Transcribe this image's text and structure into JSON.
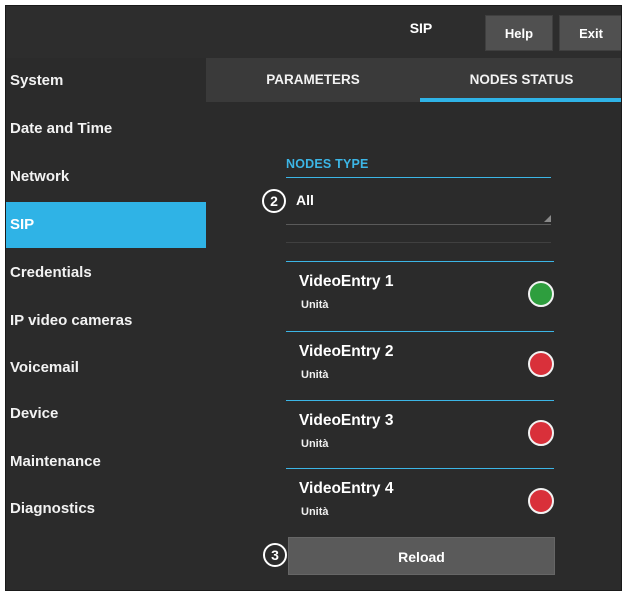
{
  "header": {
    "title": "SIP",
    "help_label": "Help",
    "exit_label": "Exit"
  },
  "sidebar": {
    "items": [
      {
        "label": "System",
        "active": false
      },
      {
        "label": "Date and Time",
        "active": false
      },
      {
        "label": "Network",
        "active": false
      },
      {
        "label": "SIP",
        "active": true
      },
      {
        "label": "Credentials",
        "active": false
      },
      {
        "label": "IP video cameras",
        "active": false
      },
      {
        "label": "Voicemail",
        "active": false
      },
      {
        "label": "Device",
        "active": false
      },
      {
        "label": "Maintenance",
        "active": false
      },
      {
        "label": "Diagnostics",
        "active": false
      }
    ]
  },
  "tabs": [
    {
      "label": "PARAMETERS",
      "active": false
    },
    {
      "label": "NODES STATUS",
      "active": true
    }
  ],
  "filter": {
    "label": "NODES TYPE",
    "value": "All"
  },
  "callouts": {
    "select": "2",
    "reload": "3"
  },
  "nodes": [
    {
      "name": "VideoEntry 1",
      "type": "Unità",
      "status_color": "#2e9e3e"
    },
    {
      "name": "VideoEntry 2",
      "type": "Unità",
      "status_color": "#d9303a"
    },
    {
      "name": "VideoEntry 3",
      "type": "Unità",
      "status_color": "#d9303a"
    },
    {
      "name": "VideoEntry 4",
      "type": "Unità",
      "status_color": "#d9303a"
    }
  ],
  "reload_label": "Reload",
  "colors": {
    "accent": "#2fb3e6",
    "background": "#2b2b2b",
    "online": "#2e9e3e",
    "offline": "#d9303a"
  }
}
